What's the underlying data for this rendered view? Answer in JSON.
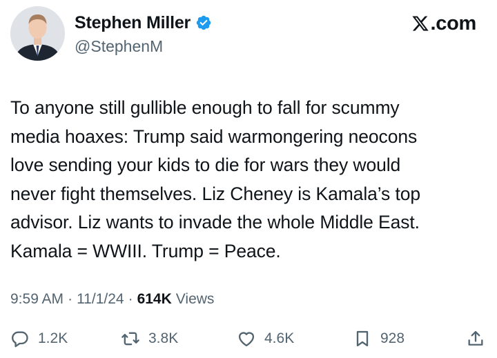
{
  "author": {
    "display_name": "Stephen Miller",
    "handle": "@StephenM",
    "verified_icon": "verified-badge-icon",
    "avatar_icon": "profile-photo"
  },
  "brand": {
    "text": ".com",
    "icon": "x-logo-icon"
  },
  "tweet": {
    "text": "To anyone still gullible enough to fall for scummy\nmedia hoaxes: Trump said warmongering neocons\nlove sending your kids to die for wars they would\nnever fight themselves. Liz Cheney is Kamala’s top\nadvisor. Liz wants to invade the whole Middle East.\nKamala = WWIII. Trump = Peace."
  },
  "meta": {
    "time": "9:59 AM",
    "date": "11/1/24",
    "separator": "·",
    "views_count": "614K",
    "views_label": "Views"
  },
  "actions": {
    "reply": {
      "count": "1.2K",
      "icon": "reply-icon"
    },
    "repost": {
      "count": "3.8K",
      "icon": "repost-icon"
    },
    "like": {
      "count": "4.6K",
      "icon": "like-heart-icon"
    },
    "bookmark": {
      "count": "928",
      "icon": "bookmark-icon"
    },
    "share": {
      "icon": "share-icon"
    }
  },
  "colors": {
    "text": "#0f1419",
    "secondary": "#536471",
    "verified": "#1d9bf0",
    "background": "#ffffff"
  }
}
